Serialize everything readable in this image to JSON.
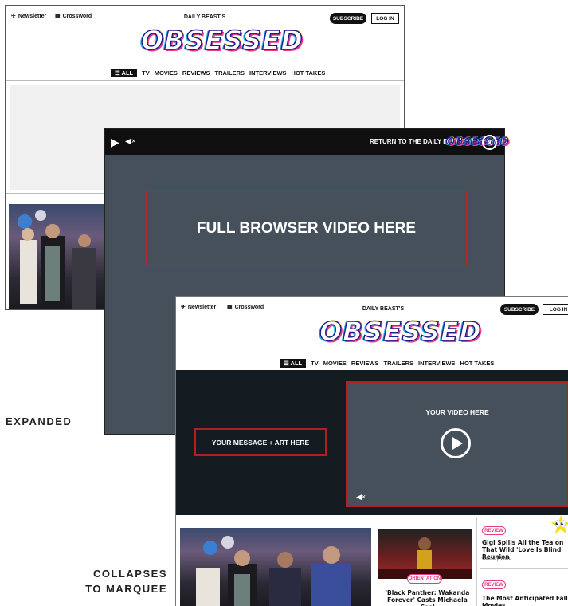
{
  "back_page": {
    "newsletter": "Newsletter",
    "crossword": "Crossword",
    "kicker": "DAILY BEAST'S",
    "logo": "OBSESSED",
    "subscribe": "SUBSCRIBE",
    "login": "LOG IN",
    "nav": [
      "ALL",
      "TV",
      "MOVIES",
      "REVIEWS",
      "TRAILERS",
      "INTERVIEWS",
      "HOT TAKES"
    ]
  },
  "video_overlay": {
    "return_text": "RETURN TO THE DAILY BEAST'S",
    "return_logo": "OBSESSED",
    "close": "X",
    "placeholder": "FULL BROWSER VIDEO HERE"
  },
  "front_page": {
    "newsletter": "Newsletter",
    "crossword": "Crossword",
    "kicker": "DAILY BEAST'S",
    "logo": "OBSESSED",
    "subscribe": "SUBSCRIBE",
    "login": "LOG IN",
    "nav": [
      "ALL",
      "TV",
      "MOVIES",
      "REVIEWS",
      "TRAILERS",
      "INTERVIEWS",
      "HOT TAKES"
    ],
    "message_placeholder": "YOUR MESSAGE + ART HERE",
    "video_placeholder": "YOUR VIDEO HERE",
    "story_center": {
      "tag": "ORIENTATION",
      "headline": "'Black Panther: Wakanda Forever' Casts Michaela Coel"
    },
    "story_right_1": {
      "tag": "REVIEW",
      "headline": "Gigi Spills All the Tea on That Wild 'Love Is Blind' Reunion",
      "byline": "Cassidy Ward"
    },
    "story_right_2": {
      "tag": "REVIEW",
      "headline": "The Most Anticipated Fall Movies,"
    }
  },
  "labels": {
    "expanded": "EXPANDED",
    "collapses_line1": "COLLAPSES",
    "collapses_line2": "TO MARQUEE"
  },
  "colors": {
    "accent_red": "#b02020",
    "tag_pink": "#e23c82",
    "video_gray": "#45505a",
    "hero_dark": "#141c22"
  }
}
